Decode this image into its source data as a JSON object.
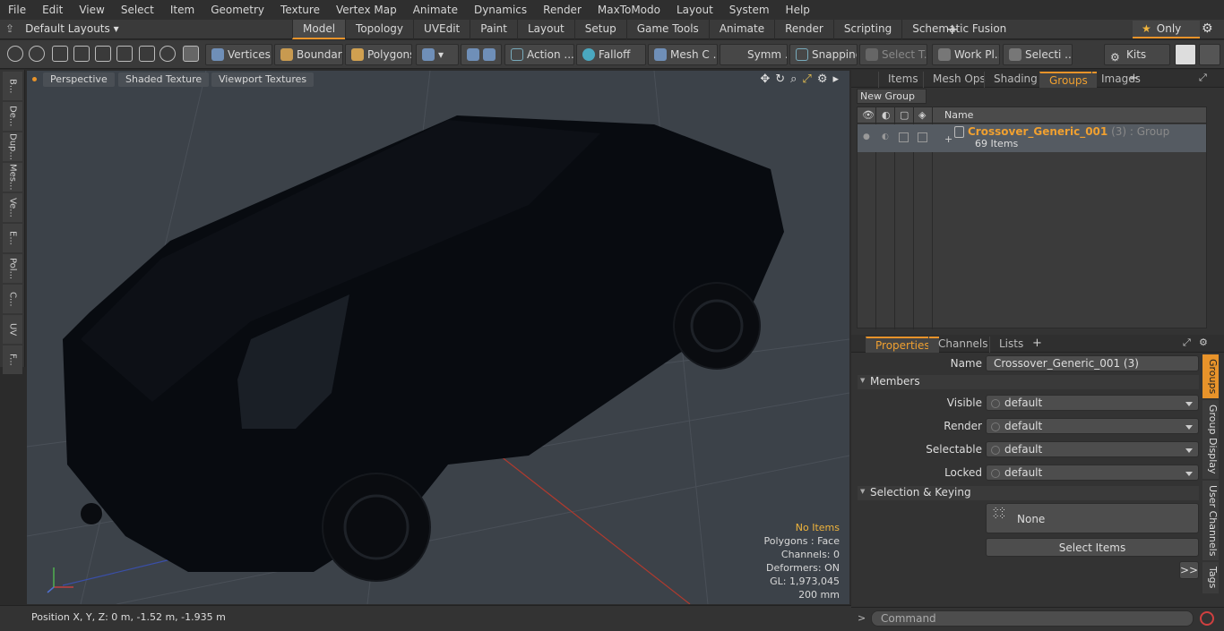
{
  "menu": [
    "File",
    "Edit",
    "View",
    "Select",
    "Item",
    "Geometry",
    "Texture",
    "Vertex Map",
    "Animate",
    "Dynamics",
    "Render",
    "MaxToModo",
    "Layout",
    "System",
    "Help"
  ],
  "layout": {
    "selector": "Default Layouts ▾",
    "tabs": [
      "Model",
      "Topology",
      "UVEdit",
      "Paint",
      "Layout",
      "Setup",
      "Game Tools",
      "Animate",
      "Render",
      "Scripting",
      "Schematic Fusion"
    ],
    "active_tab": "Model",
    "only_label": "Only"
  },
  "toolbar": {
    "vertices": "Vertices",
    "boundary": "Boundary",
    "polygons": "Polygons",
    "action": "Action ...",
    "falloff": "Falloff",
    "mesh": "Mesh C ...",
    "symm": "Symm ...",
    "snapping": "Snapping",
    "select_t": "Select T...",
    "work_pl": "Work Pl...",
    "selecti": "Selecti ...",
    "kits": "Kits"
  },
  "left_tabs": [
    "B...",
    "De...",
    "Dup...",
    "Mes...",
    "Ve...",
    "E...",
    "Pol...",
    "C...",
    "UV",
    "F..."
  ],
  "viewport": {
    "tabs": [
      "Perspective",
      "Shaded Texture",
      "Viewport Textures"
    ],
    "stats": {
      "items": "No Items",
      "polygons": "Polygons : Face",
      "channels": "Channels: 0",
      "deformers": "Deformers: ON",
      "gl": "GL: 1,973,045",
      "scale": "200 mm"
    }
  },
  "status": {
    "position": "Position X, Y, Z:   0 m, -1.52 m, -1.935 m"
  },
  "top_panel": {
    "tabs": [
      "Items",
      "Mesh Ops",
      "Shading",
      "Groups",
      "Images"
    ],
    "active": "Groups",
    "new_group": "New Group",
    "col_name": "Name",
    "group": {
      "name": "Crossover_Generic_001",
      "suffix": " (3) : Group",
      "items": "69 Items"
    }
  },
  "props": {
    "tabs": [
      "Properties",
      "Channels",
      "Lists"
    ],
    "active": "Properties",
    "name_label": "Name",
    "name_value": "Crossover_Generic_001 (3)",
    "members": "Members",
    "rows": [
      {
        "label": "Visible",
        "value": "default"
      },
      {
        "label": "Render",
        "value": "default"
      },
      {
        "label": "Selectable",
        "value": "default"
      },
      {
        "label": "Locked",
        "value": "default"
      }
    ],
    "selection": "Selection & Keying",
    "none": "None",
    "select_items": "Select Items",
    "more": ">>",
    "side_tabs": [
      "Groups",
      "Group Display",
      "User Channels",
      "Tags"
    ]
  },
  "command": {
    "placeholder": "Command"
  },
  "colors": {
    "accent": "#e8932a",
    "highlight": "#f0a030"
  }
}
